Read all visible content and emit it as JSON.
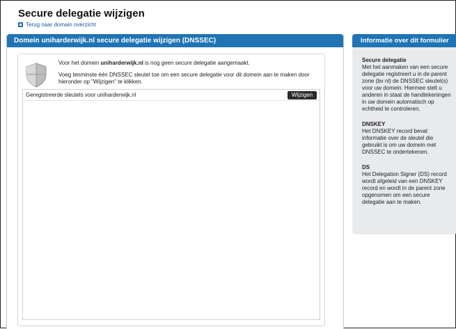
{
  "page": {
    "title": "Secure delegatie wijzigen",
    "back_link": "Terug naar domain overzicht"
  },
  "main": {
    "header": "Domein uniharderwijk.nl secure delegatie wijzigen (DNSSEC)",
    "intro_prefix": "Voor het domein ",
    "intro_domain": "uniharderwijk.nl",
    "intro_suffix": " is nog geen secure delegatie aangemaakt.",
    "instruction": "Voeg tenminste één DNSSEC sleutel toe om een secure delegatie voor dit domein aan te maken door hieronder op \"Wijzigen\" te klikken.",
    "keys_label": "Geregistreerde sleutels voor uniharderwijk.nl",
    "edit_button": "Wijzigen"
  },
  "info": {
    "header": "Informatie over dit formulier",
    "sections": [
      {
        "title": "Secure delegatie",
        "text": "Met het aanmaken van een secure delegatie registreert u in de parent zone (bv nl) de DNSSEC sleutel(s) voor uw domein. Hiermee stelt u anderen in staat de handtekeningen in uw domein automatisch op echtheid te controleren."
      },
      {
        "title": "DNSKEY",
        "text": "Het DNSKEY record bevat informatie over de sleutel die gebruikt is om uw domein met DNSSEC te ondertekenen."
      },
      {
        "title": "DS",
        "text": "Het Delegation Signer (DS) record wordt afgeleid van een DNSKEY record en wordt in de parent zone opgenomen om een secure delegatie aan te maken."
      }
    ]
  },
  "icons": {
    "shield": "shield-icon",
    "back": "back-arrow-icon"
  },
  "colors": {
    "header_blue": "#1f74b4",
    "link_blue": "#1a5aa8",
    "info_bg": "#e8eaec",
    "button_dark": "#2b2b2b"
  }
}
